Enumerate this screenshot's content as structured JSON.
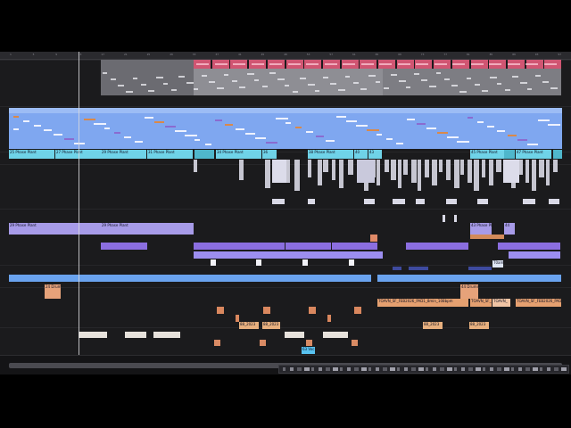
{
  "window": {
    "title": ""
  },
  "colors": {
    "background": "#1b1b1d",
    "ruler": "#2a2a2e",
    "pink": "#e05a7a",
    "gray_clip": "#8e8e94",
    "blue": "#7fa7f0",
    "cyan": "#6fd3e8",
    "white": "#d9d9e6",
    "lavender": "#a79be8",
    "purple": "#8b6ee0",
    "light_blue": "#6aa3ee",
    "orange": "#e8966a",
    "cream": "#e7e2dc",
    "light_cyan": "#58c2f0"
  },
  "ruler": {
    "ticks": [
      "1",
      "5",
      "9",
      "13",
      "17",
      "21",
      "25",
      "29",
      "33",
      "37",
      "41",
      "45",
      "49",
      "53",
      "57",
      "61",
      "65",
      "69",
      "73",
      "77",
      "81",
      "85",
      "89",
      "93",
      "97",
      "101",
      "105",
      "109",
      "113",
      "117",
      "121",
      "125"
    ]
  },
  "tracks": {
    "cyan_clips": [
      {
        "label": "25 Phase Plant"
      },
      {
        "label": "27 Phase Plant"
      },
      {
        "label": "29 Phase Plant"
      },
      {
        "label": "31 Phase Plant"
      },
      {
        "label": "34 Phase Plant"
      },
      {
        "label": "36"
      },
      {
        "label": "38 Phase Plant"
      },
      {
        "label": "40"
      },
      {
        "label": "43"
      },
      {
        "label": "45 Phase Plant"
      },
      {
        "label": "47 Phase Plant"
      }
    ],
    "lavender_clips": [
      {
        "label": "29 Phase Plant"
      },
      {
        "label": "29 Phase Plant"
      },
      {
        "label": "43 Phase Plant"
      },
      {
        "label": "44"
      }
    ],
    "fx_clips": [
      {
        "label": "24 Drums"
      },
      {
        "label": "44 Drums"
      }
    ],
    "orange_long": [
      {
        "label": "TOAVN_SF_FEB2026_PAD1_8min_108bpm"
      },
      {
        "label": "TOAVN_SF_"
      },
      {
        "label": "TOAVN_"
      },
      {
        "label": "TOAVN_SF_FEB2026_PAD"
      }
    ],
    "small_labels": [
      {
        "label": "88_2023"
      },
      {
        "label": "88_2023"
      },
      {
        "label": "88_2023"
      },
      {
        "label": "88_2023"
      }
    ],
    "tag": {
      "label": "T0am"
    },
    "bottom_clip": {
      "label": "63 Voc"
    }
  }
}
